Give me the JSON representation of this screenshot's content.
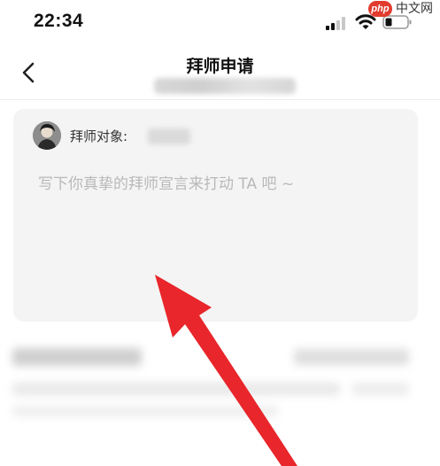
{
  "status_bar": {
    "time": "22:34",
    "watermark_badge": "php",
    "watermark_text": "中文网",
    "icons": [
      "signal-icon",
      "wifi-icon",
      "battery-icon"
    ]
  },
  "nav": {
    "title": "拜师申请",
    "back_icon": "chevron-left-icon"
  },
  "form": {
    "target_label": "拜师对象:",
    "message_placeholder": "写下你真挚的拜师宣言来打动 TA 吧 ~"
  },
  "colors": {
    "annotation_arrow": "#e8262b",
    "card_background": "#f4f4f4",
    "placeholder_text": "#b9b9b9"
  }
}
